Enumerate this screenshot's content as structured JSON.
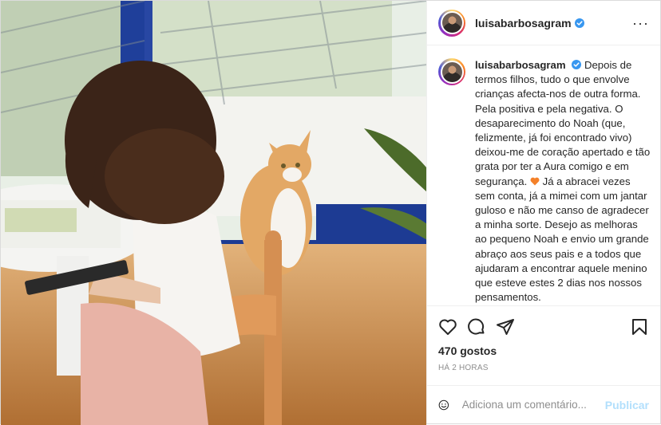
{
  "post": {
    "username": "luisabarbosagram",
    "caption": "Depois de termos filhos, tudo o que envolve crianças afecta-nos de outra forma. Pela positiva e pela negativa. O desaparecimento do Noah (que, felizmente, já foi encontrado vivo) deixou-me de coração apertado e tão grata por ter a Aura comigo e em segurança.",
    "caption_cont": "Já a abracei vezes sem conta, já a mimei com um jantar guloso e não me canso de agradecer a minha sorte. Desejo as melhoras ao pequeno Noah e envio um grande abraço aos seus pais e a todos que ajudaram a encontrar aquele menino que esteve estes 2 dias nos nossos pensamentos.",
    "caption_time": "2 h",
    "likes": "470 gostos",
    "time_ago": "HÁ 2 HORAS",
    "more_label": "···"
  },
  "comment": {
    "placeholder": "Adiciona um comentário...",
    "publish_label": "Publicar"
  },
  "icons": {
    "verified": "verified-badge-icon",
    "like": "heart-icon",
    "comment": "comment-bubble-icon",
    "share": "paper-plane-icon",
    "save": "bookmark-icon",
    "emoji": "smiley-icon",
    "caption_emoji": "orange-heart-emoji"
  },
  "colors": {
    "verified": "#3897f0",
    "caption_heart": "#f4812a",
    "publish_disabled": "#b2dffc"
  }
}
